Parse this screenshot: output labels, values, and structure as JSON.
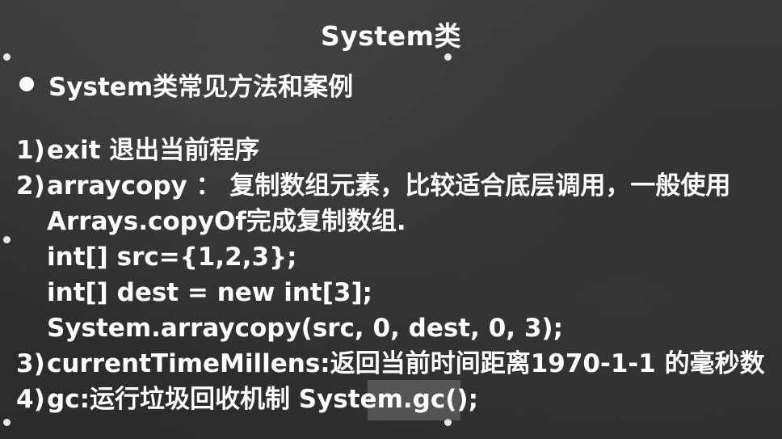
{
  "slide": {
    "title": "System类",
    "heading": "System类常见方法和案例",
    "items": [
      {
        "num": "1)",
        "text": "exit 退出当前程序"
      },
      {
        "num": "2)",
        "text": "arraycopy ： 复制数组元素，比较适合底层调用，一般使用"
      },
      {
        "num": "",
        "text": "Arrays.copyOf完成复制数组."
      },
      {
        "num": "",
        "text": "int[] src={1,2,3};"
      },
      {
        "num": "",
        "text": "int[] dest = new int[3];"
      },
      {
        "num": "",
        "text": "System.arraycopy(src, 0, dest, 0, 3);"
      },
      {
        "num": "3)",
        "text": "currentTimeMillens:返回当前时间距离1970-1-1 的毫秒数"
      },
      {
        "num": "4)",
        "text": "gc:运行垃圾回收机制 System.gc();"
      }
    ]
  }
}
